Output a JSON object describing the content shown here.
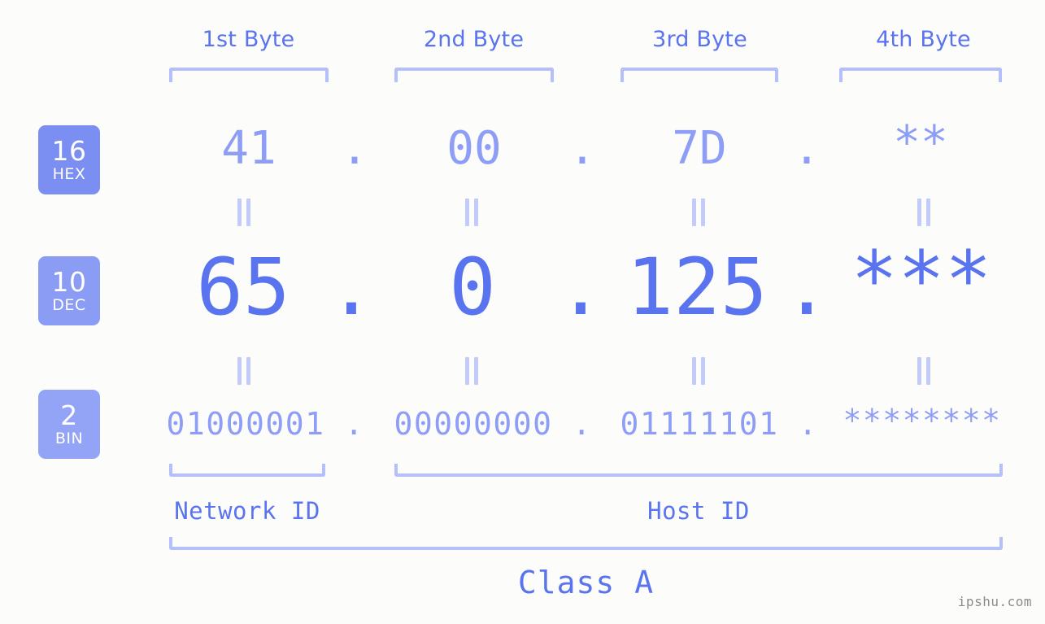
{
  "background_color": "#fcfdfa",
  "accent_colors": {
    "strong_blue": "#5a73ee",
    "mid_blue": "#8e9df6",
    "light_blue": "#b4bffb",
    "pale_blue": "#c3cbfa",
    "badge_hex": "#7b8ef2",
    "badge_dec": "#8b9cf5",
    "badge_bin": "#93a4f7",
    "watermark_gray": "#8c8c8c"
  },
  "byte_headers": [
    {
      "label": "1st Byte"
    },
    {
      "label": "2nd Byte"
    },
    {
      "label": "3rd Byte"
    },
    {
      "label": "4th Byte"
    }
  ],
  "bases": [
    {
      "number": "16",
      "name": "HEX"
    },
    {
      "number": "10",
      "name": "DEC"
    },
    {
      "number": "2",
      "name": "BIN"
    }
  ],
  "rows": {
    "hex": {
      "base_number": "16",
      "base_name": "HEX",
      "values": [
        "41",
        "00",
        "7D",
        "**"
      ],
      "separators": [
        ".",
        ".",
        "."
      ]
    },
    "dec": {
      "base_number": "10",
      "base_name": "DEC",
      "values": [
        "65",
        "0",
        "125",
        "***"
      ],
      "separators": [
        ".",
        ".",
        "."
      ]
    },
    "bin": {
      "base_number": "2",
      "base_name": "BIN",
      "values": [
        "01000001",
        "00000000",
        "01111101",
        "********"
      ],
      "separators": [
        ".",
        ".",
        "."
      ]
    }
  },
  "equality_marks": {
    "symbol": "=",
    "count_per_gap": 4,
    "gaps": 2
  },
  "sections": [
    {
      "label": "Network ID"
    },
    {
      "label": "Host ID"
    }
  ],
  "class": {
    "label": "Class A"
  },
  "watermark": {
    "text": "ipshu.com"
  }
}
